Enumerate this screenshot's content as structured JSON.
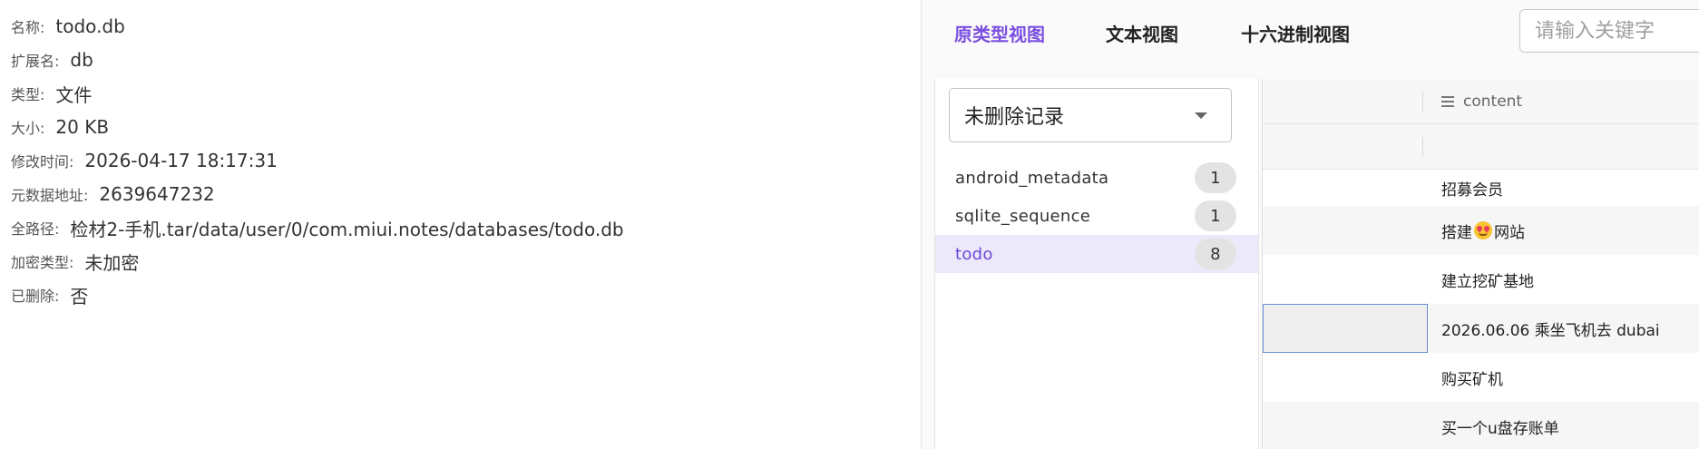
{
  "metadata": {
    "name_label": "名称:",
    "name_value": "todo.db",
    "ext_label": "扩展名:",
    "ext_value": "db",
    "type_label": "类型:",
    "type_value": "文件",
    "size_label": "大小:",
    "size_value": "20 KB",
    "mtime_label": "修改时间:",
    "mtime_value": "2026-04-17 18:17:31",
    "meta_addr_label": "元数据地址:",
    "meta_addr_value": "2639647232",
    "path_label": "全路径:",
    "path_value": "检材2-手机.tar/data/user/0/com.miui.notes/databases/todo.db",
    "enc_label": "加密类型:",
    "enc_value": "未加密",
    "deleted_label": "已删除:",
    "deleted_value": "否"
  },
  "tabs": [
    {
      "label": "原类型视图",
      "active": true
    },
    {
      "label": "文本视图",
      "active": false
    },
    {
      "label": "十六进制视图",
      "active": false
    }
  ],
  "search": {
    "placeholder": "请输入关键字",
    "value": ""
  },
  "record_filter": {
    "selected": "未删除记录"
  },
  "tables": [
    {
      "name": "android_metadata",
      "count": "1",
      "selected": false
    },
    {
      "name": "sqlite_sequence",
      "count": "1",
      "selected": false
    },
    {
      "name": "todo",
      "count": "8",
      "selected": true
    }
  ],
  "grid": {
    "column_header": "content",
    "rows": [
      {
        "content": "招募会员"
      },
      {
        "content_before": "搭建",
        "content_emoji": "smiling-face-with-heart-eyes",
        "content_after": "网站"
      },
      {
        "content": "建立挖矿基地"
      },
      {
        "content": "2026.06.06 乘坐飞机去 dubai"
      },
      {
        "content": "购买矿机"
      },
      {
        "content": "买一个u盘存账单"
      }
    ]
  },
  "colors": {
    "accent": "#7b4fe0",
    "selected_bg": "#ece9fa",
    "badge_bg": "#e3e3e3",
    "focus_border": "#6c8fd8"
  }
}
